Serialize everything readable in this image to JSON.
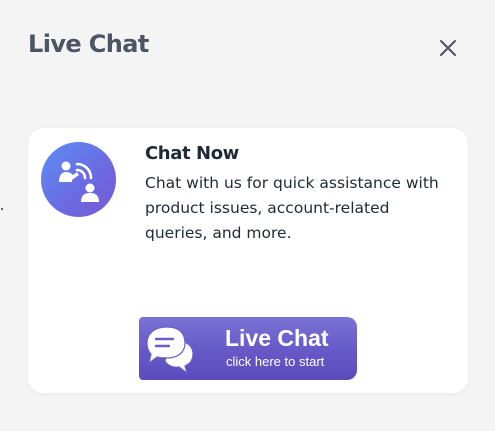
{
  "header": {
    "title": "Live Chat",
    "close_icon": "close-icon"
  },
  "card": {
    "icon": "support-agent-icon",
    "title": "Chat Now",
    "description": "Chat with us for quick assistance with product issues, account-related queries, and more."
  },
  "live_chat_button": {
    "icon": "chat-bubbles-icon",
    "label": "Live Chat",
    "sublabel": "click here to start"
  },
  "colors": {
    "page_background": "#f4f4f5",
    "title_text": "#4b5563",
    "body_text": "#1f2937",
    "avatar_gradient_start": "#5b8ff5",
    "avatar_gradient_end": "#7658d6",
    "button_gradient_start": "#7b72d6",
    "button_gradient_end": "#5b4cbd"
  }
}
